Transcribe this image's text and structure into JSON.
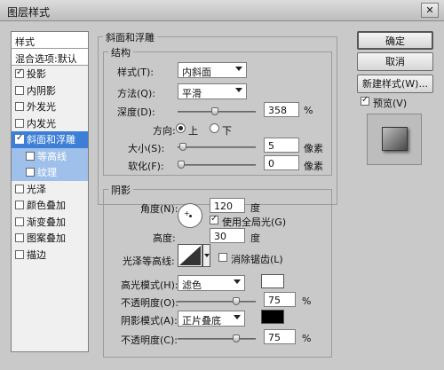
{
  "window": {
    "title": "图层样式",
    "close": "✕"
  },
  "sidebar": {
    "header": "样式",
    "blend": "混合选项:默认",
    "items": [
      {
        "label": "投影",
        "checked": true
      },
      {
        "label": "内阴影",
        "checked": false
      },
      {
        "label": "外发光",
        "checked": false
      },
      {
        "label": "内发光",
        "checked": false
      },
      {
        "label": "斜面和浮雕",
        "checked": true
      },
      {
        "label": "等高线",
        "checked": false
      },
      {
        "label": "纹理",
        "checked": false
      },
      {
        "label": "光泽",
        "checked": false
      },
      {
        "label": "颜色叠加",
        "checked": false
      },
      {
        "label": "渐变叠加",
        "checked": false
      },
      {
        "label": "图案叠加",
        "checked": false
      },
      {
        "label": "描边",
        "checked": false
      }
    ]
  },
  "bevel": {
    "group_title": "斜面和浮雕",
    "structure_title": "结构",
    "style_label": "样式(T):",
    "style_value": "内斜面",
    "technique_label": "方法(Q):",
    "technique_value": "平滑",
    "depth_label": "深度(D):",
    "depth_value": "358",
    "depth_unit": "%",
    "direction_label": "方向:",
    "direction_up": "上",
    "direction_down": "下",
    "size_label": "大小(S):",
    "size_value": "5",
    "size_unit": "像素",
    "soften_label": "软化(F):",
    "soften_value": "0",
    "soften_unit": "像素"
  },
  "shading": {
    "group_title": "阴影",
    "angle_label": "角度(N):",
    "angle_value": "120",
    "angle_unit": "度",
    "global_light_label": "使用全局光(G)",
    "global_light": true,
    "altitude_label": "高度:",
    "altitude_value": "30",
    "altitude_unit": "度",
    "gloss_label": "光泽等高线:",
    "antialias_label": "消除锯齿(L)",
    "highlight_mode_label": "高光模式(H):",
    "highlight_mode_value": "滤色",
    "highlight_color": "#ffffff",
    "highlight_opacity_label": "不透明度(O):",
    "highlight_opacity_value": "75",
    "shadow_mode_label": "阴影模式(A):",
    "shadow_mode_value": "正片叠底",
    "shadow_color": "#000000",
    "shadow_opacity_label": "不透明度(C):",
    "shadow_opacity_value": "75",
    "percent": "%"
  },
  "buttons": {
    "ok": "确定",
    "cancel": "取消",
    "new_style": "新建样式(W)...",
    "preview_label": "预览(V)",
    "preview_checked": true
  }
}
